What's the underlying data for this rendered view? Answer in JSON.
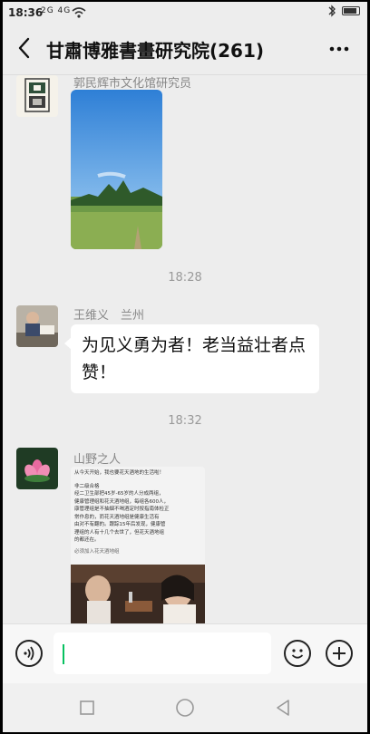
{
  "status_bar": {
    "time": "18:36",
    "signal_text": "2G 4G",
    "battery_level": 0.85
  },
  "header": {
    "title": "甘肅博雅書畫研究院(261)"
  },
  "messages": [
    {
      "sender": "郭民辉市文化馆研究员",
      "type": "image",
      "image_desc_icon": "landscape-photo"
    },
    {
      "timestamp": "18:28"
    },
    {
      "sender": "王维义　兰州",
      "type": "text",
      "text": "为见义勇为者！老当益壮者点赞！"
    },
    {
      "timestamp": "18:32"
    },
    {
      "sender": "山野之人",
      "type": "image",
      "image_lines": [
        "从今天开始，我也要花天酒地的生活啦！",
        "非二级合格",
        "经二卫生部把45岁-65岁的人分成两组，",
        "健康管理组和花天酒地组，每组各600人，",
        "康管理组是不抽烟不喝酒定时按指南体检正",
        "常作息的，而花天酒地组是健康生活有",
        "由对不有翻的。跟踪15年后发现，健康管",
        "理组的人有十几个去世了，但花天酒地组",
        "的都还在。",
        "必须加入花天酒地组"
      ]
    }
  ],
  "input_bar": {
    "voice_icon": "voice-icon",
    "emoji_icon": "emoji-icon",
    "plus_icon": "plus-icon"
  },
  "colors": {
    "background": "#ededed",
    "bubble": "#ffffff",
    "accent": "#07c160"
  }
}
